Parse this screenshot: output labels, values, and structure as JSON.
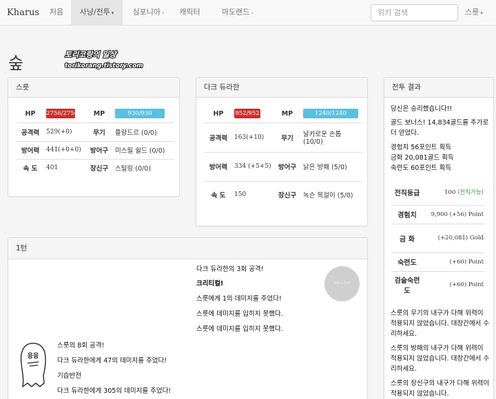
{
  "navbar": {
    "brand": "Kharus",
    "items": [
      {
        "label": "처음",
        "active": false,
        "dropdown": false
      },
      {
        "label": "사냥/전투",
        "active": true,
        "dropdown": true
      },
      {
        "label": "심포니아",
        "active": false,
        "dropdown": true
      },
      {
        "label": "캐릭터",
        "active": false,
        "dropdown": false
      },
      {
        "label": "마도랜드",
        "active": false,
        "dropdown": true
      }
    ],
    "caret": "▾",
    "search_placeholder": "위키 검색",
    "user_label": "스릇"
  },
  "page": {
    "title": "숲",
    "stamp_line1": "토리코랑의 일상",
    "stamp_line2": "torikorang.tistory.com"
  },
  "player": {
    "name": "스릇",
    "hp_label": "HP",
    "hp": "2756/2756",
    "mp_label": "MP",
    "mp": "930/930",
    "hp_fill": 1.0,
    "mp_fill": 1.0,
    "atk_label": "공격력",
    "atk": "529(+0)",
    "weapon_label": "무기",
    "weapon": "플랑드르 (0/0)",
    "def_label": "방어력",
    "def": "441(+0+0)",
    "armor_label": "방어구",
    "armor": "미스릴 쉴드 (0/0)",
    "spd_label": "속 도",
    "spd": "401",
    "acc_label": "장신구",
    "acc": "스털링 (0/0)"
  },
  "enemy": {
    "name": "다크 듀라한",
    "hp_label": "HP",
    "hp": "952/952",
    "mp_label": "MP",
    "mp": "1240/1240",
    "hp_fill": 1.0,
    "mp_fill": 1.0,
    "atk_label": "공격력",
    "atk": "163(+10)",
    "weapon_label": "무기",
    "weapon": "날카로운 손톱 (10/0)",
    "def_label": "방어력",
    "def": "334 (+5+5)",
    "armor_label": "방어구",
    "armor": "낡은 방패 (5/0)",
    "spd_label": "속 도",
    "spd": "150",
    "acc_label": "장신구",
    "acc": "녹슨 목걸이 (5/0)"
  },
  "turn": {
    "title": "1턴",
    "enemy_log": [
      "다크 듀라한의 3회 공격!",
      "크리티컬!",
      "스릇에게 1의 데미지를 주었다!",
      "스릇에 데미지를 입히지 못했다.",
      "스릇에 데미지를 입히지 못했다."
    ],
    "player_log": [
      "스릇의 8회 공격!",
      "다크 듀라한에게 47의 데미지를 주었다!",
      "기습반전",
      "다크 듀라한에게 305의 데미지를 주었다!"
    ],
    "enemy_avatar_text": "500 x 500"
  },
  "result": {
    "title": "전투 결과",
    "victory": "당신은 승리했습니다!!",
    "bonus": "골드 보너스! 14,834골드를 추가로 더 얻었다.",
    "gains": [
      "경험치 56포인트 획득",
      "금화 20,081골드 획득",
      "숙련도 60포인트 획득"
    ],
    "rows": [
      {
        "label": "전직등급",
        "value": "100",
        "extra": "(전직가능)"
      },
      {
        "label": "경험치",
        "value": "9,900 (+56) Point"
      },
      {
        "label": "금 화",
        "value": "(+20,081) Gold"
      },
      {
        "label": "숙련도",
        "value": "(+60) Point"
      },
      {
        "label": "검술숙련도",
        "value": "(+60) Point"
      }
    ],
    "durability": [
      "스릇의 무기의 내구가 다해 위력이 적용되지 않았습니다. 대장간에서 수리하세요.",
      "스릇의 방패의 내구가 다해 위력이 적용되지 않았습니다. 대장간에서 수리하세요.",
      "스릇의 장신구의 내구가 다해 위력이 적용되지 않았습니다."
    ]
  }
}
